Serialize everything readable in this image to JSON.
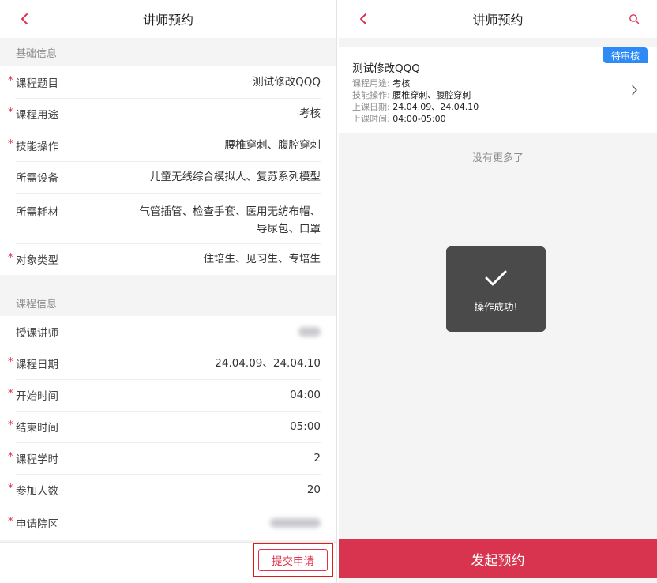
{
  "left": {
    "title": "讲师预约",
    "section_basic": "基础信息",
    "basic_rows": [
      {
        "label": "课程题目",
        "value": "测试修改QQQ",
        "required": true
      },
      {
        "label": "课程用途",
        "value": "考核",
        "required": true
      },
      {
        "label": "技能操作",
        "value": "腰椎穿刺、腹腔穿刺",
        "required": true
      },
      {
        "label": "所需设备",
        "value": "儿童无线综合模拟人、复苏系列模型",
        "required": false
      },
      {
        "label": "所需耗材",
        "value_line1": "气管插管、检查手套、医用无纺布帽、",
        "value_line2": "导尿包、口罩",
        "required": false
      },
      {
        "label": "对象类型",
        "value": "住培生、见习生、专培生",
        "required": true
      }
    ],
    "section_course": "课程信息",
    "course_rows": [
      {
        "label": "授课讲师",
        "value": "",
        "required": false
      },
      {
        "label": "课程日期",
        "value": "24.04.09、24.04.10",
        "required": true
      },
      {
        "label": "开始时间",
        "value": "04:00",
        "required": true
      },
      {
        "label": "结束时间",
        "value": "05:00",
        "required": true
      },
      {
        "label": "课程学时",
        "value": "2",
        "required": true
      },
      {
        "label": "参加人数",
        "value": "20",
        "required": true
      },
      {
        "label": "申请院区",
        "value": "",
        "required": true
      }
    ],
    "required_mark": "*",
    "submit_label": "提交申请"
  },
  "right": {
    "title": "讲师预约",
    "card": {
      "title": "测试修改QQQ",
      "badge": "待审核",
      "lines": [
        {
          "key": "课程用途:",
          "value": "考核"
        },
        {
          "key": "技能操作:",
          "value": "腰椎穿刺、腹腔穿刺"
        },
        {
          "key": "上课日期:",
          "value": "24.04.09、24.04.10"
        },
        {
          "key": "上课时间:",
          "value": "04:00-05:00"
        }
      ]
    },
    "no_more": "没有更多了",
    "toast": "操作成功!",
    "book_label": "发起预约"
  },
  "colors": {
    "accent_red": "#d9344f",
    "required_red": "#e0324d",
    "badge_blue": "#2e8bf5",
    "toast_bg": "#4a4a4a"
  },
  "icons": {
    "back": "chevron-left-icon",
    "search": "search-icon",
    "chevron": "chevron-right-icon",
    "success": "checkmark-icon"
  }
}
